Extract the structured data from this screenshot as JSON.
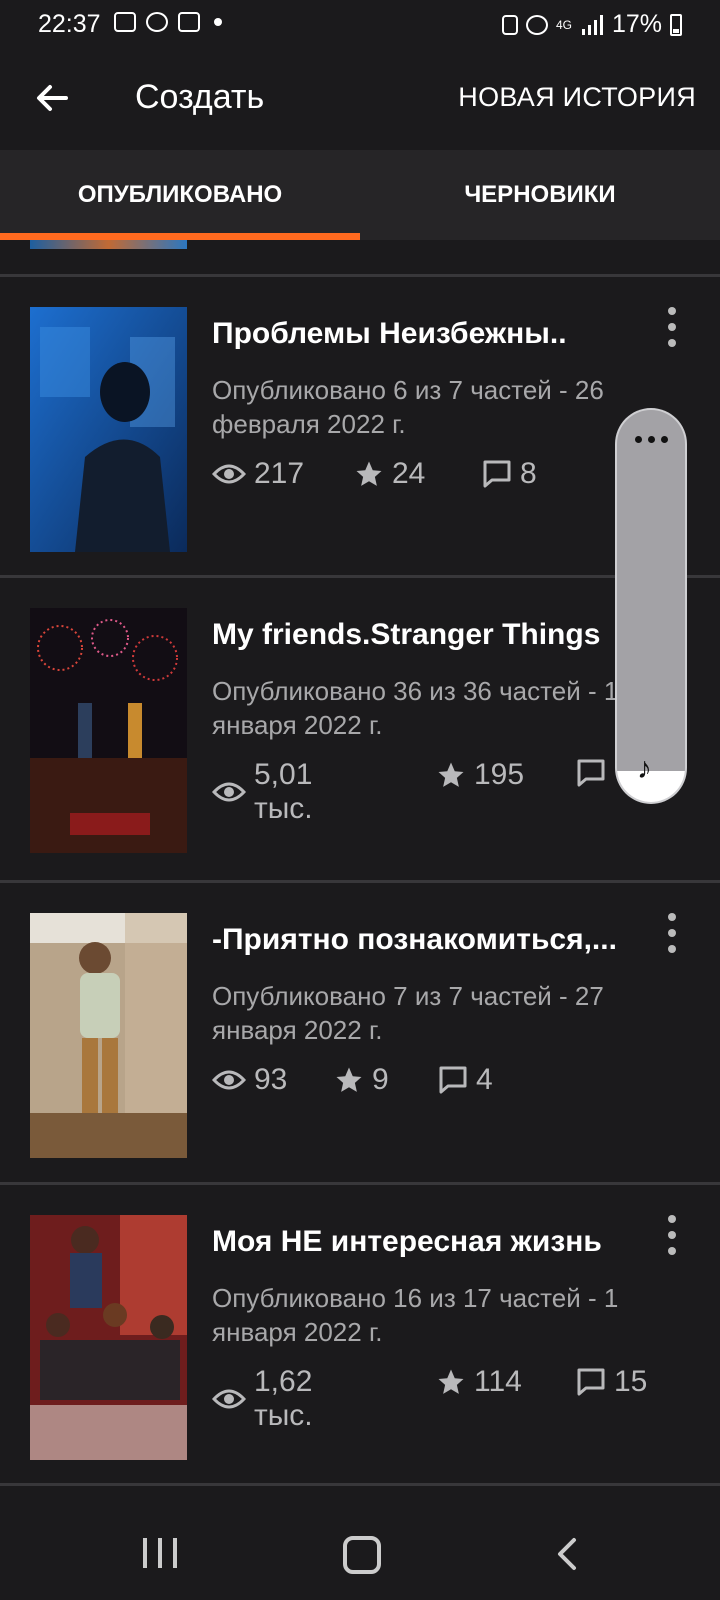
{
  "status_bar": {
    "time": "22:37",
    "battery": "17%",
    "network": "4G"
  },
  "app_bar": {
    "title": "Создать",
    "new_story_label": "НОВАЯ ИСТОРИЯ"
  },
  "tabs": [
    {
      "label": "ОПУБЛИКОВАНО",
      "active": true
    },
    {
      "label": "ЧЕРНОВИКИ",
      "active": false
    }
  ],
  "stories": [
    {
      "title": "Проблемы Неизбежны..",
      "meta": "Опубликовано 6 из 7 частей - 26 февраля 2022 г.",
      "views": "217",
      "votes": "24",
      "comments": "8"
    },
    {
      "title": "My friends.Stranger Things",
      "meta": "Опубликовано 36 из 36 частей - 1 января 2022 г.",
      "views": "5,01 тыс.",
      "votes": "195",
      "comments": ""
    },
    {
      "title": "-Приятно познакомиться,...",
      "meta": "Опубликовано 7 из 7 частей - 27 января 2022 г.",
      "views": "93",
      "votes": "9",
      "comments": "4"
    },
    {
      "title": "Моя НЕ интересная жизнь",
      "meta": "Опубликовано 16 из 17 частей - 1 января 2022 г.",
      "views": "1,62 тыс.",
      "votes": "114",
      "comments": "15"
    }
  ],
  "volume_overlay": {
    "level": 0.08,
    "icon": "music-note-icon"
  },
  "colors": {
    "background": "#1b1a1c",
    "tab_bar": "#262527",
    "accent": "#ff6a1f",
    "meta_text": "#a8a8aa"
  }
}
